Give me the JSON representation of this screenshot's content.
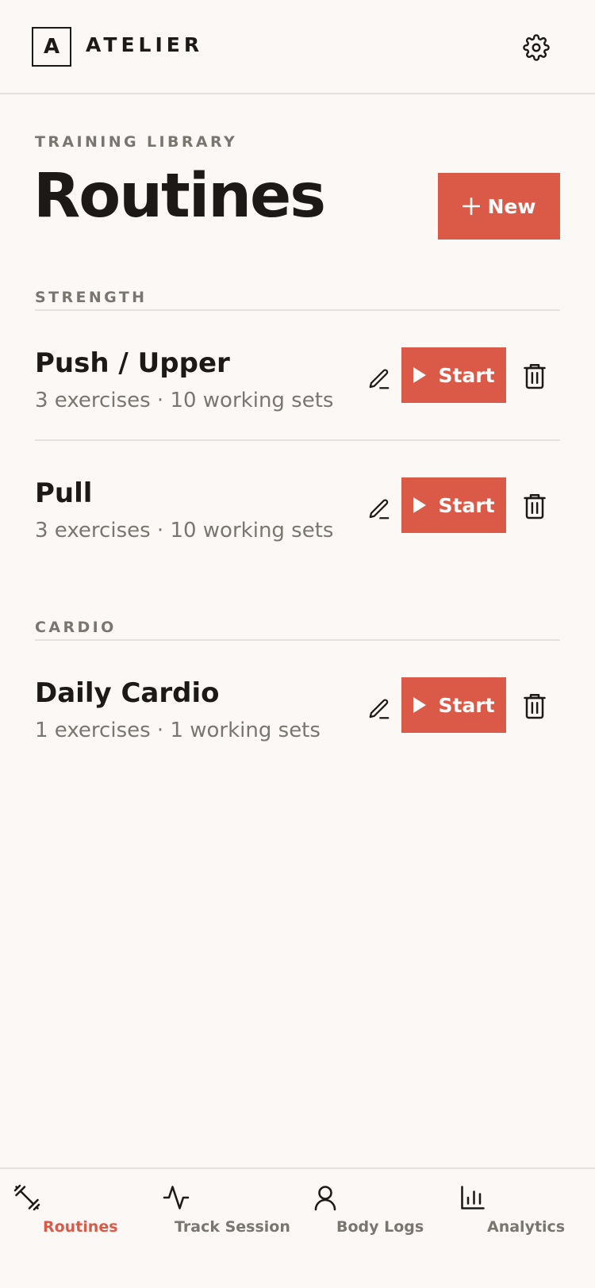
{
  "app": {
    "logo_letter": "A",
    "name": "ATELIER",
    "settings_icon": "gear-icon"
  },
  "page": {
    "eyebrow": "TRAINING LIBRARY",
    "title": "Routines",
    "new_button": {
      "icon": "plus-icon",
      "label": "New"
    }
  },
  "sections": [
    {
      "label": "STRENGTH",
      "routines": [
        {
          "name": "Push / Upper",
          "meta": "3 exercises · 10 working sets",
          "start_label": "Start"
        },
        {
          "name": "Pull",
          "meta": "3 exercises · 10 working sets",
          "start_label": "Start"
        }
      ]
    },
    {
      "label": "CARDIO",
      "routines": [
        {
          "name": "Daily Cardio",
          "meta": "1 exercises · 1 working sets",
          "start_label": "Start"
        }
      ]
    }
  ],
  "bottom_nav": [
    {
      "label": "Routines",
      "icon": "dumbbell-icon",
      "active": true
    },
    {
      "label": "Track Session",
      "icon": "activity-icon",
      "active": false
    },
    {
      "label": "Body Logs",
      "icon": "user-icon",
      "active": false
    },
    {
      "label": "Analytics",
      "icon": "bar-chart-icon",
      "active": false
    }
  ],
  "colors": {
    "accent": "#DB5A47",
    "background": "#FCF8F5",
    "text": "#1C1917",
    "muted": "#7A756F",
    "divider": "#E5E1DD"
  }
}
